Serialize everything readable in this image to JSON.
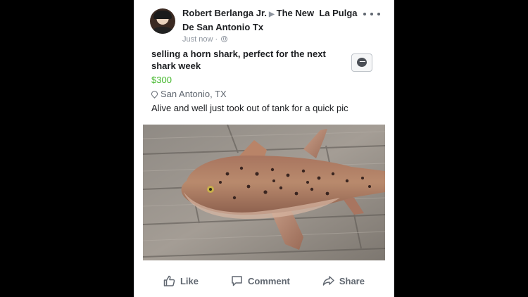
{
  "post": {
    "author": "Robert Berlanga Jr.",
    "group": "The New  La Pulga De San Antonio Tx",
    "timestamp": "Just now",
    "privacy_icon": "globe-icon"
  },
  "listing": {
    "title": "selling a horn shark, perfect for the next shark week",
    "price": "$300",
    "location": "San Antonio, TX",
    "description": "Alive and well just took out of tank for a quick pic",
    "message_icon": "messenger-icon"
  },
  "photo": {
    "subject": "horn-shark-photo"
  },
  "actions": {
    "like": "Like",
    "comment": "Comment",
    "share": "Share"
  },
  "colors": {
    "price": "#42b72a",
    "text": "#1c1e21",
    "muted": "#606770",
    "background": "#000000"
  }
}
